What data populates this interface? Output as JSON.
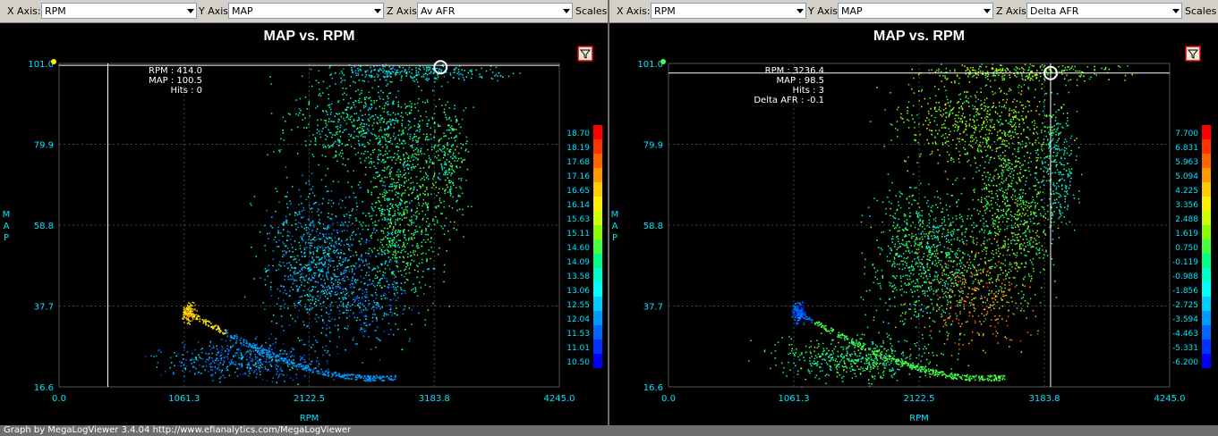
{
  "panels": [
    {
      "toolbar": {
        "x_axis_label": "X Axis:",
        "x_axis_value": "RPM",
        "y_axis_label": "Y Axis:",
        "y_axis_value": "MAP",
        "z_axis_label": "Z Axis:",
        "z_axis_value": "Av AFR",
        "scales_label": "Scales"
      },
      "tooltip": [
        "RPM : 414.0",
        "MAP : 100.5",
        "Hits : 0"
      ],
      "cursor": {
        "x": 414.0,
        "y": 100.5
      },
      "filter_icon": "funnel-icon"
    },
    {
      "toolbar": {
        "x_axis_label": "X Axis:",
        "x_axis_value": "RPM",
        "y_axis_label": "Y Axis:",
        "y_axis_value": "MAP",
        "z_axis_label": "Z Axis:",
        "z_axis_value": "Delta AFR",
        "scales_label": "Scales"
      },
      "tooltip": [
        "RPM : 3236.4",
        "MAP : 98.5",
        "Hits : 3",
        "Delta AFR : -0.1"
      ],
      "cursor": {
        "x": 3236.4,
        "y": 98.5
      },
      "filter_icon": "funnel-icon"
    }
  ],
  "chart_data": [
    {
      "type": "scatter",
      "title": "MAP vs. RPM",
      "xlabel": "RPM",
      "ylabel": "MAP",
      "xlim": [
        0.0,
        4245.0
      ],
      "ylim": [
        16.6,
        101.0
      ],
      "x_ticks": [
        "0.0",
        "1061.3",
        "2122.5",
        "3183.8",
        "4245.0"
      ],
      "y_ticks": [
        "101.0",
        "79.9",
        "58.8",
        "37.7",
        "16.6"
      ],
      "z_axis": "Av AFR",
      "color_scale": [
        "18.70",
        "18.19",
        "17.68",
        "17.16",
        "16.65",
        "16.14",
        "15.63",
        "15.11",
        "14.60",
        "14.09",
        "13.58",
        "13.06",
        "12.55",
        "12.04",
        "11.53",
        "11.01",
        "10.50"
      ],
      "grid": true,
      "legend": "right"
    },
    {
      "type": "scatter",
      "title": "MAP vs. RPM",
      "xlabel": "RPM",
      "ylabel": "MAP",
      "xlim": [
        0.0,
        4245.0
      ],
      "ylim": [
        16.6,
        101.0
      ],
      "x_ticks": [
        "0.0",
        "1061.3",
        "2122.5",
        "3183.8",
        "4245.0"
      ],
      "y_ticks": [
        "101.0",
        "79.9",
        "58.8",
        "37.7",
        "16.6"
      ],
      "z_axis": "Delta AFR",
      "color_scale": [
        "7.700",
        "6.831",
        "5.963",
        "5.094",
        "4.225",
        "3.356",
        "2.488",
        "1.619",
        "0.750",
        "-0.119",
        "-0.988",
        "-1.856",
        "-2.725",
        "-3.594",
        "-4.463",
        "-5.331",
        "-6.200"
      ],
      "grid": true,
      "legend": "right"
    }
  ],
  "colors": {
    "tick_text": "#00e5ff",
    "title_text": "#ffffff",
    "scale": [
      "#ff0000",
      "#ff3300",
      "#ff6600",
      "#ff9900",
      "#ffcc00",
      "#ffee00",
      "#ccff00",
      "#88ff00",
      "#44ff44",
      "#00ff88",
      "#00ffcc",
      "#00ffff",
      "#00ccff",
      "#0099ff",
      "#0066ff",
      "#0033ff",
      "#0000ff"
    ]
  },
  "status_bar": "Graph by MegaLogViewer 3.4.04 http://www.efianalytics.com/MegaLogViewer"
}
